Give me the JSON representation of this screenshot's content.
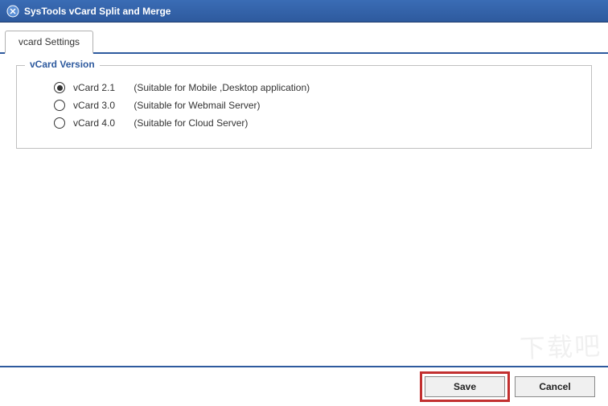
{
  "titlebar": {
    "title": "SysTools  vCard Split and Merge"
  },
  "tabs": {
    "items": [
      {
        "label": "vcard Settings",
        "active": true
      }
    ]
  },
  "fieldset": {
    "legend": "vCard Version",
    "options": [
      {
        "version": "vCard 2.1",
        "desc": "(Suitable for Mobile ,Desktop application)",
        "selected": true
      },
      {
        "version": "vCard 3.0",
        "desc": "(Suitable for Webmail Server)",
        "selected": false
      },
      {
        "version": "vCard 4.0",
        "desc": "(Suitable for Cloud Server)",
        "selected": false
      }
    ]
  },
  "footer": {
    "save_label": "Save",
    "cancel_label": "Cancel"
  },
  "watermark": "下载吧"
}
